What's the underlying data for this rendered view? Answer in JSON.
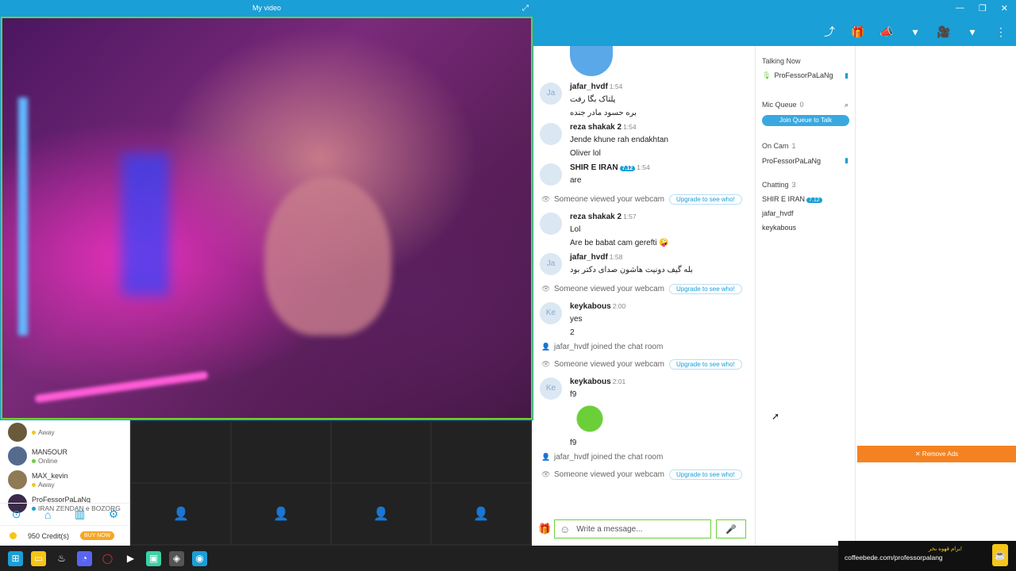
{
  "video": {
    "title": "My video"
  },
  "left_users": [
    {
      "name": "",
      "status": "Away",
      "color": "#f5c518"
    },
    {
      "name": "MAN5OUR",
      "status": "Online",
      "color": "#6bcf3a"
    },
    {
      "name": "MAX_kevin",
      "status": "Away",
      "color": "#f5c518"
    },
    {
      "name": "ProFessorPaLaNg",
      "status": "IRAN ZENDAN e BOZORG",
      "color": "#1a9fd6"
    }
  ],
  "left_nav": [
    "compass-icon",
    "home-icon",
    "chart-icon",
    "settings-icon"
  ],
  "credits": {
    "text": "950 Credit(s)",
    "buy": "BUY NOW"
  },
  "chat": {
    "messages": [
      {
        "type": "msg",
        "initials": "Ja",
        "user": "jafar_hvdf",
        "time": "1:54",
        "lines": [
          "پلتاک بگا رفت",
          "بره حسود مادر جنده"
        ]
      },
      {
        "type": "msg",
        "initials": "",
        "user": "reza shakak 2",
        "time": "1:54",
        "lines": [
          "Jende khune rah endakhtan",
          "Oliver lol"
        ]
      },
      {
        "type": "msg",
        "initials": "",
        "user": "SHIR E IRAN",
        "badge": "7.12",
        "time": "1:54",
        "lines": [
          "are"
        ]
      },
      {
        "type": "sys",
        "text": "Someone viewed your webcam",
        "upgrade": "Upgrade to see who!"
      },
      {
        "type": "msg",
        "initials": "",
        "user": "reza shakak 2",
        "time": "1:57",
        "lines": [
          "Lol",
          "Are be babat cam gerefti 🤪"
        ]
      },
      {
        "type": "msg",
        "initials": "Ja",
        "user": "jafar_hvdf",
        "time": "1:58",
        "lines": [
          "بله گیف دونیت هاشون صدای دکتر بود"
        ]
      },
      {
        "type": "sys",
        "text": "Someone viewed your webcam",
        "upgrade": "Upgrade to see who!"
      },
      {
        "type": "msg",
        "initials": "Ke",
        "user": "keykabous",
        "time": "2:00",
        "lines": [
          "yes",
          "2"
        ]
      },
      {
        "type": "join",
        "text": "jafar_hvdf joined the chat room"
      },
      {
        "type": "sys",
        "text": "Someone viewed your webcam",
        "upgrade": "Upgrade to see who!"
      },
      {
        "type": "msg",
        "initials": "Ke",
        "user": "keykabous",
        "time": "2:01",
        "lines": [
          "f9",
          "",
          "f9"
        ]
      },
      {
        "type": "join",
        "text": "jafar_hvdf joined the chat room"
      },
      {
        "type": "sys",
        "text": "Someone viewed your webcam",
        "upgrade": "Upgrade to see who!"
      }
    ],
    "placeholder": "Write a message..."
  },
  "side": {
    "talking_now": "Talking Now",
    "talker": "ProFessorPaLaNg",
    "mic_queue": "Mic Queue",
    "mic_queue_count": "0",
    "join_queue": "Join Queue to Talk",
    "on_cam": "On Cam",
    "on_cam_count": "1",
    "on_cam_user": "ProFessorPaLaNg",
    "chatting": "Chatting",
    "chatting_count": "3",
    "chatting_users": [
      "SHIR E IRAN",
      "jafar_hvdf",
      "keykabous"
    ],
    "chatting_badge": "7.12"
  },
  "ad": {
    "remove": "✕ Remove Ads"
  },
  "promo": {
    "line1": "برام قهوه بخر!",
    "url": "coffeebede.com/professorpalang"
  }
}
